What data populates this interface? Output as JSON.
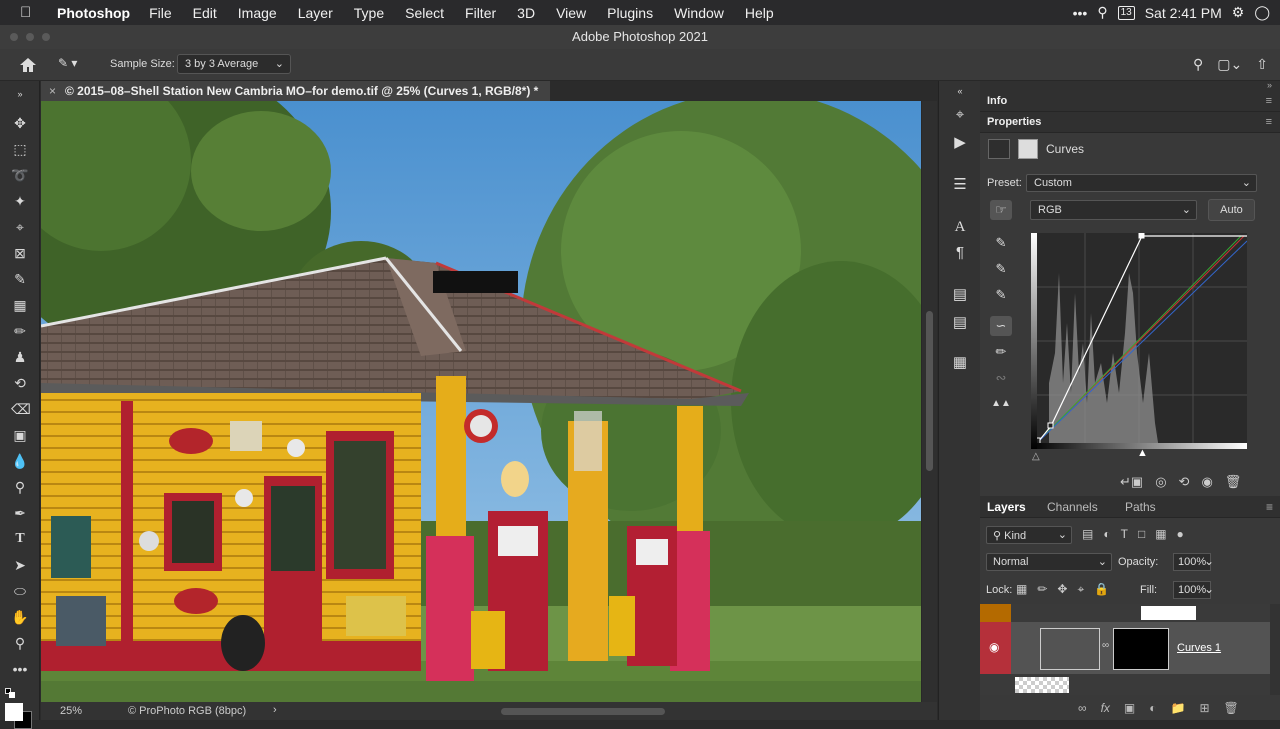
{
  "menubar": {
    "app_name": "Photoshop",
    "items": [
      "File",
      "Edit",
      "Image",
      "Layer",
      "Type",
      "Select",
      "Filter",
      "3D",
      "View",
      "Plugins",
      "Window",
      "Help"
    ],
    "calendar_day": "13",
    "clock": "Sat 2:41 PM"
  },
  "window": {
    "title": "Adobe Photoshop 2021"
  },
  "options_bar": {
    "sample_size_label": "Sample Size:",
    "sample_size_value": "3 by 3 Average"
  },
  "document": {
    "tab_title": "© 2015–08–Shell Station New Cambria MO–for demo.tif @ 25% (Curves 1, RGB/8*) *",
    "zoom": "25%",
    "color_profile": "ProPhoto RGB (8bpc)"
  },
  "panels": {
    "info_tab": "Info",
    "properties_tab": "Properties",
    "adjustment_name": "Curves",
    "preset_label": "Preset:",
    "preset_value": "Custom",
    "channel_value": "RGB",
    "auto_button": "Auto"
  },
  "curves": {
    "rgb_points": [
      [
        0,
        0
      ],
      [
        22,
        30
      ],
      [
        255,
        255
      ]
    ],
    "black_input": 0,
    "white_input": 133
  },
  "layers": {
    "tabs": [
      "Layers",
      "Channels",
      "Paths"
    ],
    "filter_kind": "Kind",
    "blend_mode": "Normal",
    "opacity_label": "Opacity:",
    "opacity_value": "100%",
    "lock_label": "Lock:",
    "fill_label": "Fill:",
    "fill_value": "100%",
    "selected_layer_name": "Curves 1"
  }
}
